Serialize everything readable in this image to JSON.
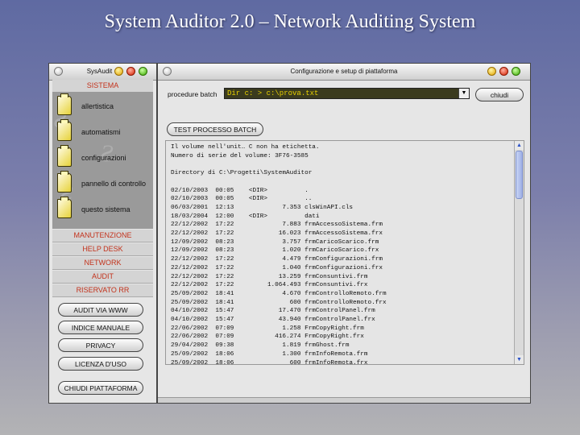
{
  "slide": {
    "title": "System Auditor 2.0 – Network Auditing System"
  },
  "left_window": {
    "title": "SysAudit",
    "section_top": "SISTEMA",
    "tree_items": [
      {
        "label": "allertistica"
      },
      {
        "label": "automatismi"
      },
      {
        "label": "configurazioni"
      },
      {
        "label": "pannello di controllo"
      },
      {
        "label": "questo sistema"
      }
    ],
    "sections": [
      "MANUTENZIONE",
      "HELP DESK",
      "NETWORK",
      "AUDIT",
      "RISERVATO RR"
    ],
    "buttons": [
      "AUDIT VIA WWW",
      "INDICE MANUALE",
      "PRIVACY",
      "LICENZA D'USO",
      "CHIUDI PIATTAFORMA"
    ]
  },
  "right_window": {
    "title": "Configurazione e setup di piattaforma",
    "procedure_label": "procedure batch",
    "procedure_value": "Dir c: > c:\\prova.txt",
    "close_button": "chiudi",
    "test_button": "TEST PROCESSO BATCH",
    "output_lines": [
      "Il volume nell'unit… C non ha etichetta.",
      "Numero di serie del volume: 3F76-3585",
      "",
      "Directory di C:\\Progetti\\SystemAuditor",
      "",
      "02/10/2003  00:05    <DIR>          .",
      "02/10/2003  00:05    <DIR>          ..",
      "06/03/2001  12:13             7.353 clsWinAPI.cls",
      "18/03/2004  12:00    <DIR>          dati",
      "22/12/2002  17:22             7.883 frmAccessoSistema.frm",
      "22/12/2002  17:22            16.023 frmAccessoSistema.frx",
      "12/09/2002  08:23             3.757 frmCaricoScarico.frm",
      "12/09/2002  08:23             1.020 frmCaricoScarico.frx",
      "22/12/2002  17:22             4.479 frmConfigurazioni.frm",
      "22/12/2002  17:22             1.040 frmConfigurazioni.frx",
      "22/12/2002  17:22            13.259 frmConsuntivi.frm",
      "22/12/2002  17:22         1.064.493 frmConsuntivi.frx",
      "25/09/2002  18:41             4.670 frmControlloRemoto.frm",
      "25/09/2002  18:41               600 frmControlloRemoto.frx",
      "04/10/2002  15:47            17.470 frmControlPanel.frm",
      "04/10/2002  15:47            43.940 frmControlPanel.frx",
      "22/06/2002  07:09             1.258 FrmCopyRight.frm",
      "22/06/2002  07:09           416.274 FrmCopyRight.frx",
      "29/04/2002  09:38             1.819 frmGhost.frm",
      "25/09/2002  18:06             1.300 frmInfoRemota.frm",
      "25/09/2002  18:06               600 frmInfoRemota.frx"
    ]
  },
  "colors": {
    "section_text": "#c3321b",
    "combo_text": "#e8d000",
    "combo_bg": "#3b3b1e"
  },
  "icons": [
    "folder-icon",
    "close-icon",
    "minimize-icon",
    "maximize-icon",
    "zoom-icon",
    "chevron-down-icon",
    "scroll-up-icon",
    "scroll-down-icon"
  ]
}
